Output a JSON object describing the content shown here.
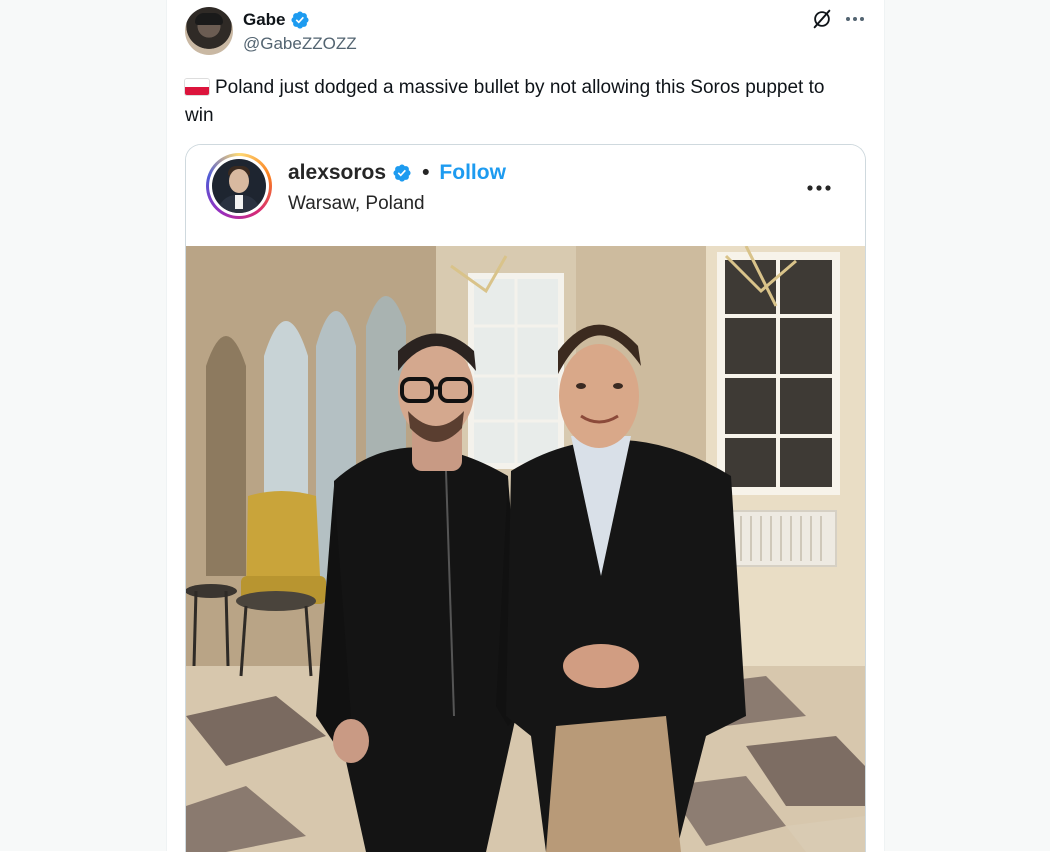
{
  "tweet": {
    "author_name": "Gabe",
    "author_handle": "@GabeZZOZZ",
    "text": "Poland just dodged a massive bullet by not allowing this Soros puppet to win",
    "flag_icon": "poland-flag-icon"
  },
  "embedded_post": {
    "username": "alexsoros",
    "separator": "•",
    "follow_label": "Follow",
    "location": "Warsaw, Poland"
  },
  "colors": {
    "accent": "#1d9bf0",
    "text_primary": "#0f1419",
    "text_secondary": "#536471",
    "border": "#cfd9de"
  }
}
